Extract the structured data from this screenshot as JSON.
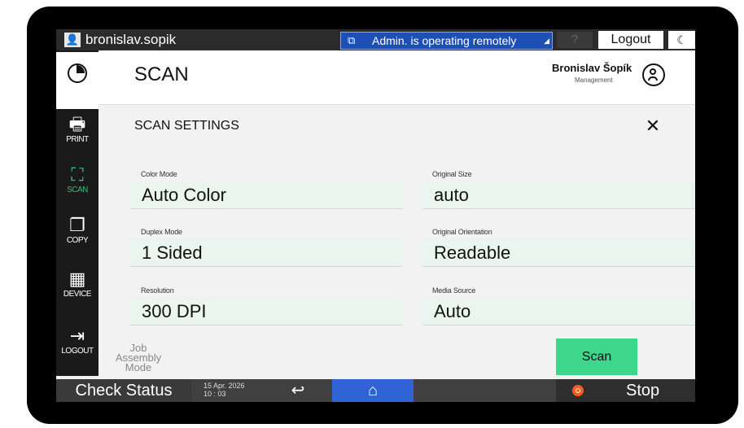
{
  "topbar": {
    "user_name": "bronislav.sopik",
    "remote_status": "Admin. is operating remotely",
    "help": "?",
    "logout": "Logout"
  },
  "sidebar": {
    "items": [
      {
        "label": "PRINT",
        "icon": "printer-icon",
        "glyph": "🖶"
      },
      {
        "label": "SCAN",
        "icon": "scan-icon",
        "glyph": "⛶"
      },
      {
        "label": "COPY",
        "icon": "copy-icon",
        "glyph": "❐"
      },
      {
        "label": "DEVICE",
        "icon": "device-icon",
        "glyph": "▦"
      },
      {
        "label": "LOGOUT",
        "icon": "logout-icon",
        "glyph": "⇥"
      }
    ]
  },
  "header": {
    "title": "SCAN",
    "user_display_name": "Bronislav Šopík",
    "user_department": "Management"
  },
  "settings": {
    "title": "SCAN SETTINGS",
    "color_mode": {
      "label": "Color Mode",
      "value": "Auto Color"
    },
    "original_size": {
      "label": "Original Size",
      "value": "auto"
    },
    "duplex_mode": {
      "label": "Duplex Mode",
      "value": "1 Sided"
    },
    "original_orientation": {
      "label": "Original Orientation",
      "value": "Readable"
    },
    "resolution": {
      "label": "Resolution",
      "value": "300 DPI"
    },
    "media_source": {
      "label": "Media Source",
      "value": "Auto"
    }
  },
  "job_assembly": {
    "line1": "Job Assembly",
    "line2": "Mode"
  },
  "scan_button": "Scan",
  "bottombar": {
    "check_status": "Check Status",
    "date": "15 Apr. 2026",
    "time": "10 : 03",
    "stop": "Stop"
  },
  "colors": {
    "accent_green": "#3dd68a",
    "home_blue": "#2f63d6",
    "remote_blue": "#1e4fb7",
    "stop_orange": "#ff5a1f"
  }
}
